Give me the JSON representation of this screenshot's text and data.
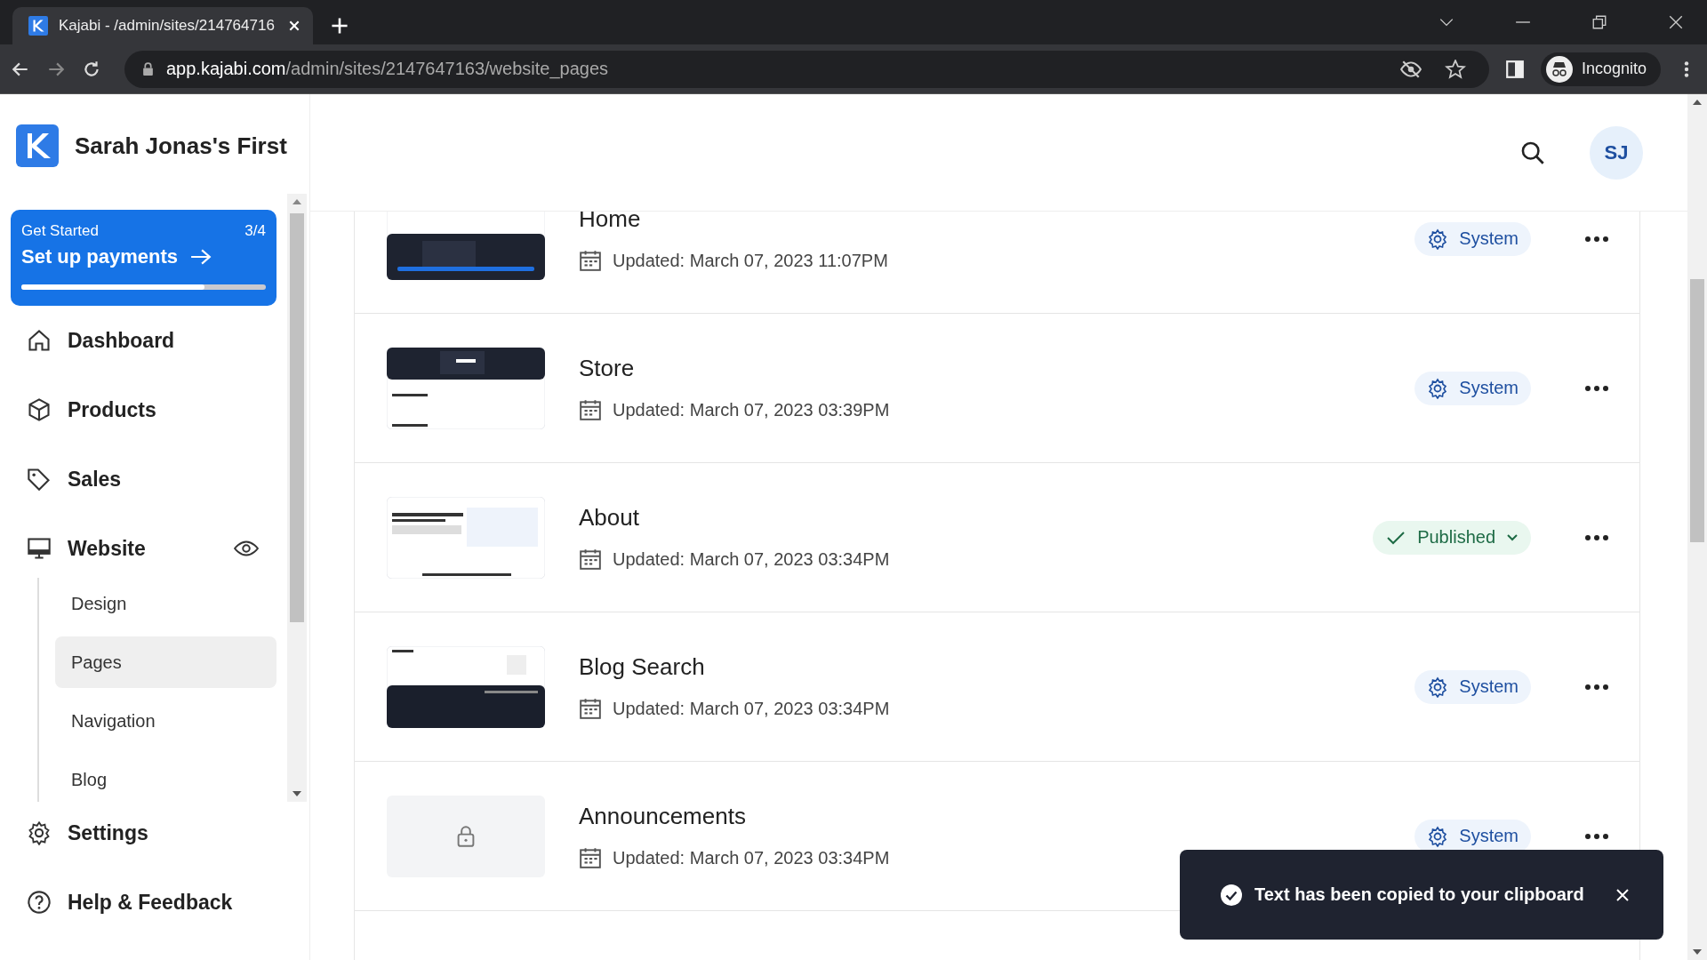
{
  "browser": {
    "tab_title": "Kajabi - /admin/sites/214764716",
    "url_host": "app.kajabi.com",
    "url_path": "/admin/sites/2147647163/website_pages",
    "profile": "Incognito"
  },
  "sidebar": {
    "site_name": "Sarah Jonas's First",
    "get_started": {
      "label": "Get Started",
      "count": "3/4",
      "action": "Set up payments",
      "level": 0.75
    },
    "items": [
      {
        "label": "Dashboard",
        "selected": false
      },
      {
        "label": "Products",
        "selected": false
      },
      {
        "label": "Sales",
        "selected": false
      },
      {
        "label": "Website",
        "selected": false,
        "expanded": true,
        "children": [
          {
            "label": "Design",
            "selected": false
          },
          {
            "label": "Pages",
            "selected": true
          },
          {
            "label": "Navigation",
            "selected": false
          },
          {
            "label": "Blog",
            "selected": false
          }
        ]
      }
    ],
    "footer_items": [
      {
        "label": "Settings"
      },
      {
        "label": "Help & Feedback"
      }
    ]
  },
  "header": {
    "avatar": "SJ"
  },
  "pages": [
    {
      "title": "Home",
      "updated": "Updated: March 07, 2023 11:07PM",
      "status": {
        "kind": "system",
        "label": "System"
      }
    },
    {
      "title": "Store",
      "updated": "Updated: March 07, 2023 03:39PM",
      "status": {
        "kind": "system",
        "label": "System"
      }
    },
    {
      "title": "About",
      "updated": "Updated: March 07, 2023 03:34PM",
      "status": {
        "kind": "published",
        "label": "Published"
      }
    },
    {
      "title": "Blog Search",
      "updated": "Updated: March 07, 2023 03:34PM",
      "status": {
        "kind": "system",
        "label": "System"
      }
    },
    {
      "title": "Announcements",
      "updated": "Updated: March 07, 2023 03:34PM",
      "thumbnail": {
        "kind": "locked"
      },
      "status": {
        "kind": "system",
        "label": "System"
      }
    }
  ],
  "toast": {
    "message": "Text has been copied to your clipboard"
  }
}
